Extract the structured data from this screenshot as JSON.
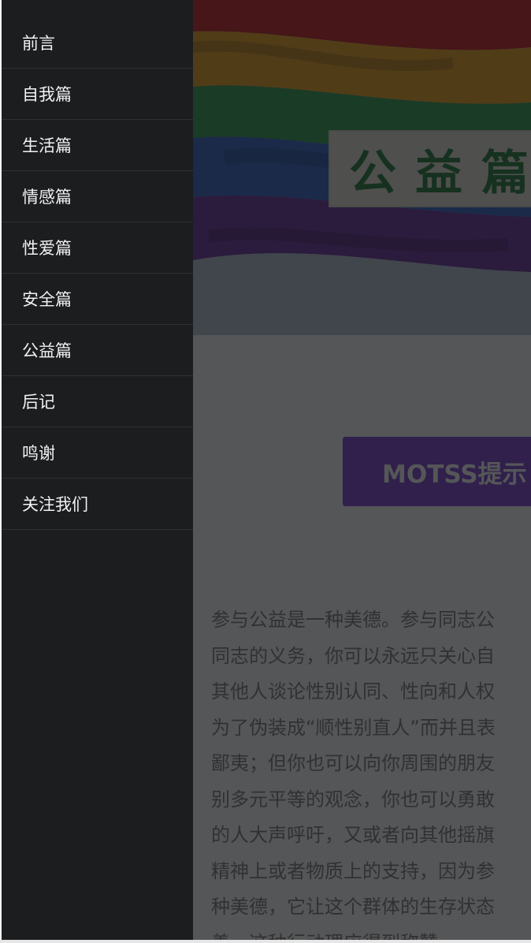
{
  "sidebar": {
    "items": [
      {
        "label": "前言"
      },
      {
        "label": "自我篇"
      },
      {
        "label": "生活篇"
      },
      {
        "label": "情感篇"
      },
      {
        "label": "性爱篇"
      },
      {
        "label": "安全篇"
      },
      {
        "label": "公益篇"
      },
      {
        "label": "后记"
      },
      {
        "label": "鸣谢"
      },
      {
        "label": "关注我们"
      }
    ]
  },
  "hero": {
    "title": "公益篇",
    "flag_colors": [
      "#c81a1a",
      "#f0a21a",
      "#2e9e4a",
      "#2f62c9",
      "#6a2c9e"
    ]
  },
  "tip_button": {
    "label": "MOTSS提示",
    "color": "#7b3fd1"
  },
  "article": {
    "lines": [
      "参与公益是一种美德。参与同志公",
      "同志的义务，你可以永远只关心自",
      "其他人谈论性别认同、性向和人权",
      "为了伪装成“顺性别直人”而并且表",
      "鄙夷；但你也可以向你周围的朋友",
      "别多元平等的观念，你也可以勇敢",
      "的人大声呼吁，又或者向其他摇旗",
      "精神上或者物质上的支持，因为参",
      "种美德，它让这个群体的生存状态",
      "善，这种行动理应得到称赞。"
    ]
  }
}
